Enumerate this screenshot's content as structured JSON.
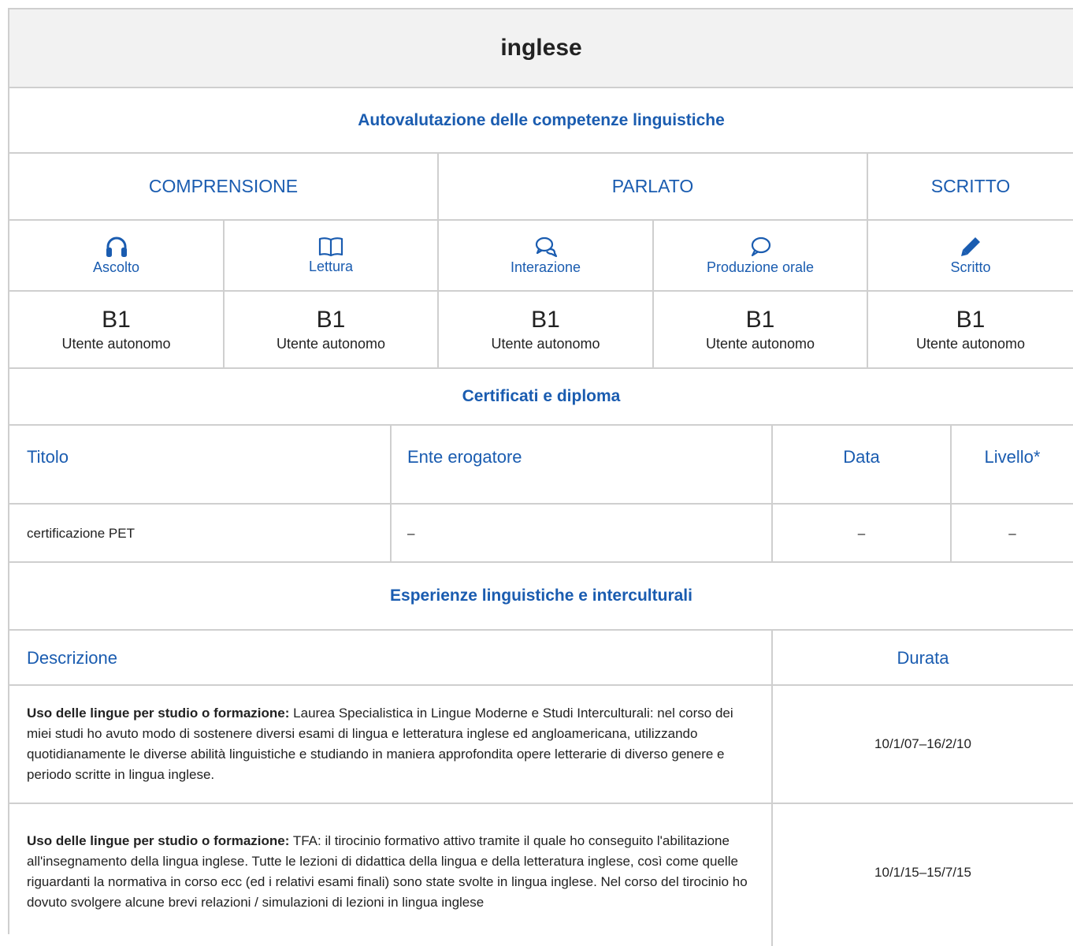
{
  "language": "inglese",
  "self_assessment": {
    "heading": "Autovalutazione delle competenze linguistiche",
    "groups": [
      "COMPRENSIONE",
      "PARLATO",
      "SCRITTO"
    ],
    "skills": [
      {
        "label": "Ascolto",
        "icon": "headphones-icon",
        "level": "B1",
        "level_desc": "Utente autonomo"
      },
      {
        "label": "Lettura",
        "icon": "book-icon",
        "level": "B1",
        "level_desc": "Utente autonomo"
      },
      {
        "label": "Interazione",
        "icon": "chat-bubbles-icon",
        "level": "B1",
        "level_desc": "Utente autonomo"
      },
      {
        "label": "Produzione orale",
        "icon": "speech-bubble-icon",
        "level": "B1",
        "level_desc": "Utente autonomo"
      },
      {
        "label": "Scritto",
        "icon": "pencil-icon",
        "level": "B1",
        "level_desc": "Utente autonomo"
      }
    ]
  },
  "certificates": {
    "heading": "Certificati e diploma",
    "columns": [
      "Titolo",
      "Ente erogatore",
      "Data",
      "Livello*"
    ],
    "rows": [
      {
        "titolo": "certificazione PET",
        "ente": "–",
        "data": "–",
        "livello": "–"
      }
    ]
  },
  "experiences": {
    "heading": "Esperienze linguistiche e interculturali",
    "columns": [
      "Descrizione",
      "Durata"
    ],
    "rows": [
      {
        "type": "Uso delle lingue per studio o formazione:",
        "text": "Laurea Specialistica in Lingue Moderne e Studi Interculturali: nel corso dei miei studi ho avuto modo di sostenere diversi esami di lingua e letteratura inglese ed angloamericana, utilizzando quotidianamente le diverse abilità linguistiche e studiando in maniera approfondita opere letterarie di diverso genere e periodo scritte in lingua inglese.",
        "duration": "10/1/07–16/2/10"
      },
      {
        "type": "Uso delle lingue per studio o formazione:",
        "text": "TFA: il tirocinio formativo attivo tramite il quale ho conseguito l'abilitazione all'insegnamento della lingua inglese. Tutte le lezioni di didattica della lingua e della letteratura inglese, così come quelle riguardanti la normativa in corso ecc (ed i relativi esami finali) sono state svolte in lingua inglese. Nel corso del tirocinio ho dovuto svolgere alcune brevi relazioni / simulazioni di lezioni in lingua inglese",
        "duration": "10/1/15–15/7/15"
      }
    ]
  },
  "colors": {
    "accent": "#1a5cb0",
    "border": "#cfcfcf",
    "header_bg": "#f2f2f2"
  }
}
